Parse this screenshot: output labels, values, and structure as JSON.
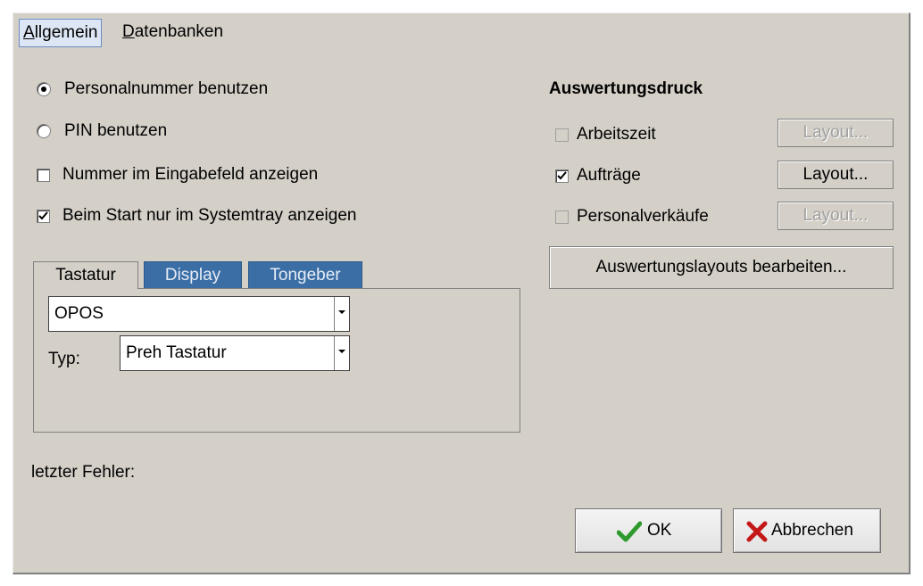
{
  "tabs": {
    "allgemein_prefix": "A",
    "allgemein_rest": "llgemein",
    "datenbanken_prefix": "D",
    "datenbanken_rest": "atenbanken"
  },
  "options": {
    "radio_personalnummer": "Personalnummer benutzen",
    "radio_pin": "PIN benutzen",
    "check_nummer": "Nummer im Eingabefeld anzeigen",
    "check_systemtray": "Beim Start nur im Systemtray anzeigen",
    "radio_selected": "personalnummer"
  },
  "device_tabs": [
    "Tastatur",
    "Display",
    "Tongeber"
  ],
  "device": {
    "driver_value": "OPOS",
    "typ_label": "Typ:",
    "typ_value": "Preh Tastatur"
  },
  "error_label": "letzter Fehler:",
  "auswertung": {
    "title": "Auswertungsdruck",
    "items": [
      {
        "label": "Arbeitszeit",
        "checked": false,
        "button": "Layout...",
        "enabled": false
      },
      {
        "label": "Aufträge",
        "checked": true,
        "button": "Layout...",
        "enabled": true
      },
      {
        "label": "Personalverkäufe",
        "checked": false,
        "button": "Layout...",
        "enabled": false
      }
    ],
    "edit_button": "Auswertungslayouts bearbeiten..."
  },
  "buttons": {
    "ok": "OK",
    "cancel": "Abbrechen"
  },
  "colors": {
    "dialog_bg": "#d4d0c8",
    "inactive_tab": "#3a6ea5",
    "ok_check": "#2e9a2e",
    "cancel_x": "#c41818"
  }
}
